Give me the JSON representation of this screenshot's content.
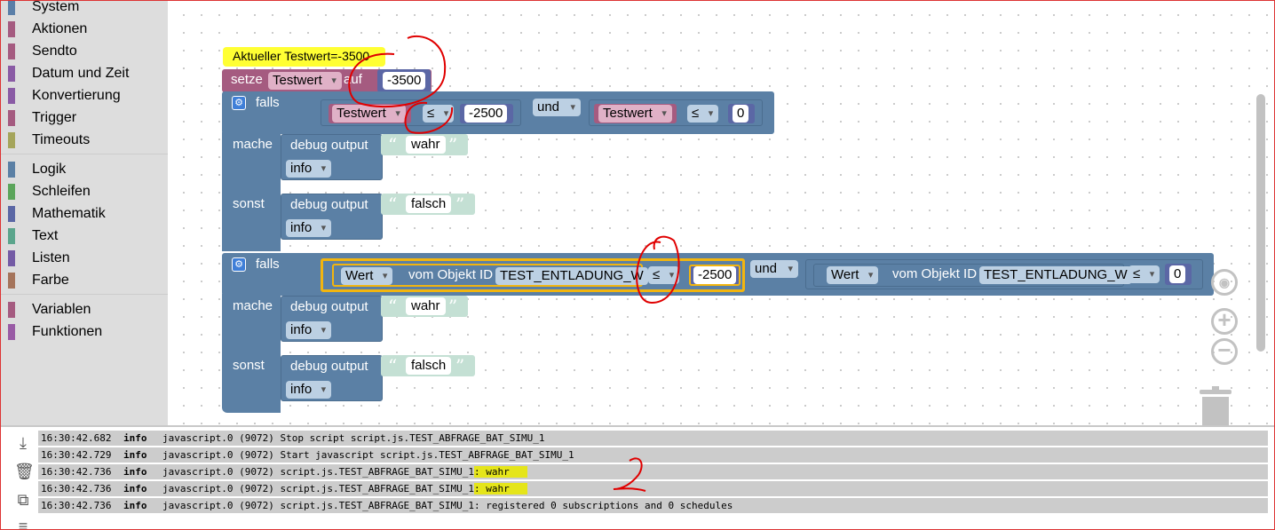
{
  "toolbox": {
    "categories": [
      {
        "label": "System",
        "color": "#5b7fa8"
      },
      {
        "label": "Aktionen",
        "color": "#a55b80"
      },
      {
        "label": "Sendto",
        "color": "#a55b80"
      },
      {
        "label": "Datum und Zeit",
        "color": "#8a5ba5"
      },
      {
        "label": "Konvertierung",
        "color": "#8a5ba5"
      },
      {
        "label": "Trigger",
        "color": "#a55b80"
      },
      {
        "label": "Timeouts",
        "color": "#a5a55b"
      },
      {
        "label": "Logik",
        "color": "#5b80a5"
      },
      {
        "label": "Schleifen",
        "color": "#5ba55b"
      },
      {
        "label": "Mathematik",
        "color": "#5b67a5"
      },
      {
        "label": "Text",
        "color": "#5ba58c"
      },
      {
        "label": "Listen",
        "color": "#745ba5"
      },
      {
        "label": "Farbe",
        "color": "#a5745b"
      },
      {
        "label": "Variablen",
        "color": "#a55b80"
      },
      {
        "label": "Funktionen",
        "color": "#995ba5"
      }
    ]
  },
  "workspace": {
    "comment": "Aktueller Testwert=-3500",
    "set_block": {
      "keyword": "setze",
      "variable": "Testwert",
      "to": "auf",
      "value": "-3500"
    },
    "if1": {
      "if_label": "falls",
      "left_var": "Testwert",
      "op1": "≤",
      "val1": "-2500",
      "and": "und",
      "right_var": "Testwert",
      "op2": "≤",
      "val2": "0",
      "do_label": "mache",
      "do_debug": "debug output",
      "do_value": "wahr",
      "do_level": "info",
      "else_label": "sonst",
      "else_debug": "debug output",
      "else_value": "falsch",
      "else_level": "info"
    },
    "if2": {
      "if_label": "falls",
      "left_attr": "Wert",
      "left_of": "vom Objekt ID",
      "left_obj": "TEST_ENTLADUNG_W",
      "op1": "≤",
      "val1": "-2500",
      "and": "und",
      "right_attr": "Wert",
      "right_of": "vom Objekt ID",
      "right_obj": "TEST_ENTLADUNG_W",
      "op2": "≤",
      "val2": "0",
      "do_label": "mache",
      "do_debug": "debug output",
      "do_value": "wahr",
      "do_level": "info",
      "else_label": "sonst",
      "else_debug": "debug output",
      "else_value": "falsch",
      "else_level": "info"
    },
    "colors": {
      "logic": "#5b80a5",
      "variable": "#a55b80",
      "math": "#5b67a5",
      "text": "#5ba58c",
      "highlight": "#f2b50f",
      "annotation": "#e00000"
    }
  },
  "annotations": {
    "mark_number": "2"
  },
  "log": {
    "rows": [
      {
        "time": "16:30:42.682",
        "level": "info",
        "msg": "javascript.0 (9072) Stop script script.js.TEST_ABFRAGE_BAT_SIMU_1",
        "hl": ""
      },
      {
        "time": "16:30:42.729",
        "level": "info",
        "msg": "javascript.0 (9072) Start javascript script.js.TEST_ABFRAGE_BAT_SIMU_1",
        "hl": ""
      },
      {
        "time": "16:30:42.736",
        "level": "info",
        "msg": "javascript.0 (9072) script.js.TEST_ABFRAGE_BAT_SIMU_1",
        "hl": ": wahr"
      },
      {
        "time": "16:30:42.736",
        "level": "info",
        "msg": "javascript.0 (9072) script.js.TEST_ABFRAGE_BAT_SIMU_1",
        "hl": ": wahr"
      },
      {
        "time": "16:30:42.736",
        "level": "info",
        "msg": "javascript.0 (9072) script.js.TEST_ABFRAGE_BAT_SIMU_1: registered 0 subscriptions and 0 schedules",
        "hl": ""
      }
    ],
    "tools": [
      {
        "name": "scroll-down-icon",
        "glyph": "⤓"
      },
      {
        "name": "delete-icon",
        "glyph": "🗑"
      },
      {
        "name": "copy-icon",
        "glyph": "⧉"
      },
      {
        "name": "list-icon",
        "glyph": "≡"
      }
    ]
  }
}
